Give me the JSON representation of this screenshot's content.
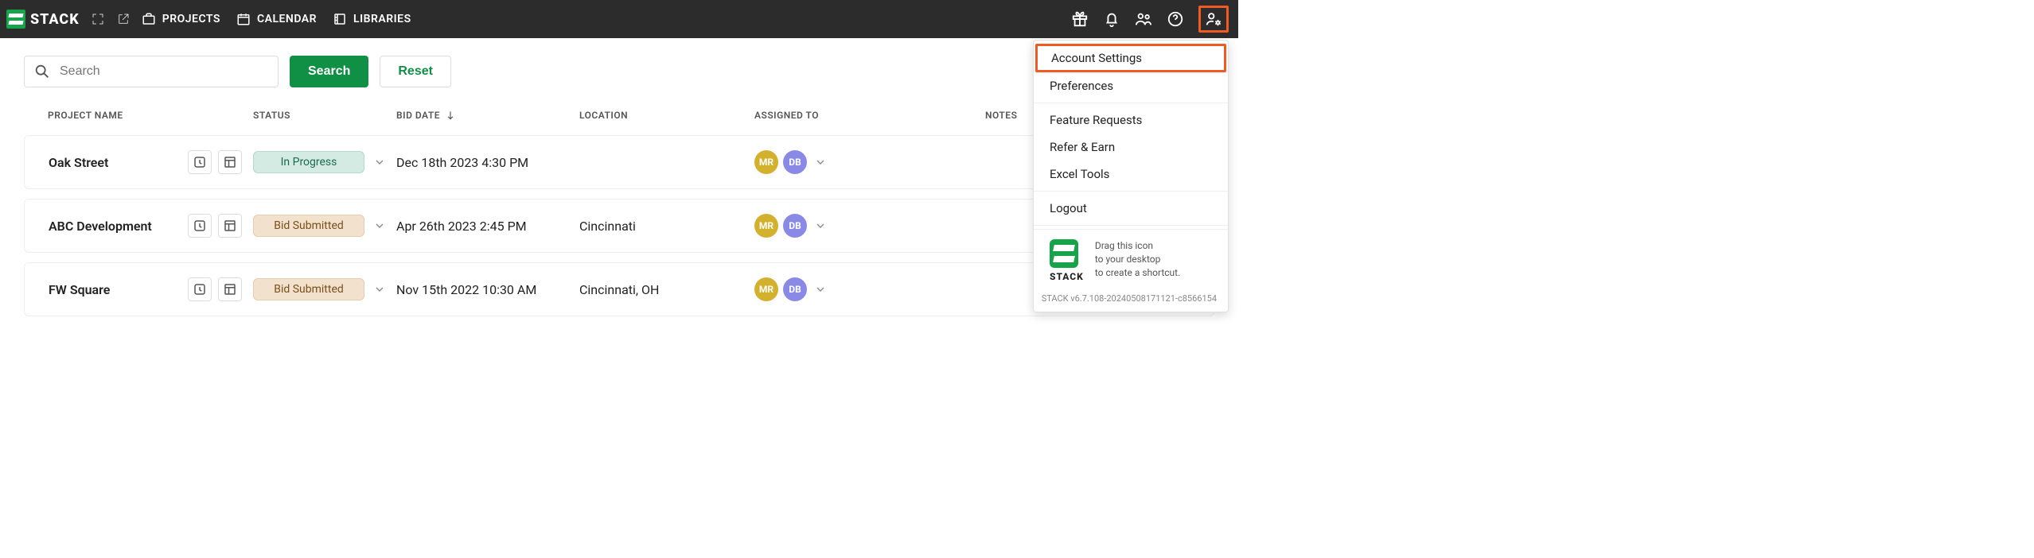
{
  "brand": {
    "name": "STACK"
  },
  "nav": {
    "projects": "PROJECTS",
    "calendar": "CALENDAR",
    "libraries": "LIBRARIES"
  },
  "toolbar": {
    "search_placeholder": "Search",
    "search_label": "Search",
    "reset_label": "Reset"
  },
  "table": {
    "headers": {
      "project_name": "PROJECT NAME",
      "status": "STATUS",
      "bid_date": "BID DATE",
      "location": "LOCATION",
      "assigned_to": "ASSIGNED TO",
      "notes": "NOTES"
    },
    "rows": [
      {
        "name": "Oak Street",
        "status": {
          "label": "In Progress",
          "class": "status-inprogress"
        },
        "bid_date": "Dec 18th 2023 4:30 PM",
        "location": "",
        "assigned": [
          {
            "initials": "MR",
            "class": "mr"
          },
          {
            "initials": "DB",
            "class": "db"
          }
        ]
      },
      {
        "name": "ABC Development",
        "status": {
          "label": "Bid Submitted",
          "class": "status-bidsubmitted"
        },
        "bid_date": "Apr 26th 2023 2:45 PM",
        "location": "Cincinnati",
        "assigned": [
          {
            "initials": "MR",
            "class": "mr"
          },
          {
            "initials": "DB",
            "class": "db"
          }
        ]
      },
      {
        "name": "FW Square",
        "status": {
          "label": "Bid Submitted",
          "class": "status-bidsubmitted"
        },
        "bid_date": "Nov 15th 2022 10:30 AM",
        "location": "Cincinnati, OH",
        "assigned": [
          {
            "initials": "MR",
            "class": "mr"
          },
          {
            "initials": "DB",
            "class": "db"
          }
        ]
      }
    ]
  },
  "menu": {
    "account_settings": "Account Settings",
    "preferences": "Preferences",
    "feature_requests": "Feature Requests",
    "refer_earn": "Refer & Earn",
    "excel_tools": "Excel Tools",
    "logout": "Logout",
    "tip_line1": "Drag this icon",
    "tip_line2": "to your desktop",
    "tip_line3": "to create a shortcut.",
    "version": "STACK v6.7.108-20240508171121-c8566154",
    "mini_name": "STACK"
  }
}
